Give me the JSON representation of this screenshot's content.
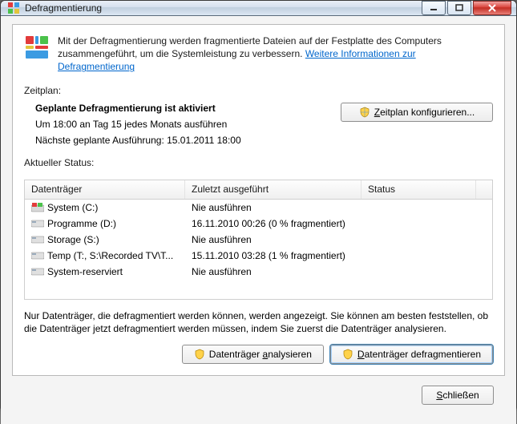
{
  "window": {
    "title": "Defragmentierung"
  },
  "intro": {
    "text": "Mit der Defragmentierung werden fragmentierte Dateien auf der Festplatte des Computers zusammengeführt, um die Systemleistung zu verbessern. ",
    "link": "Weitere Informationen zur Defragmentierung"
  },
  "schedule": {
    "label": "Zeitplan:",
    "heading": "Geplante Defragmentierung ist aktiviert",
    "line1": "Um 18:00 an Tag 15 jedes Monats ausführen",
    "line2": "Nächste geplante Ausführung: 15.01.2011 18:00",
    "configure_btn": "Zeitplan konfigurieren..."
  },
  "status": {
    "label": "Aktueller Status:",
    "columns": {
      "c1": "Datenträger",
      "c2": "Zuletzt ausgeführt",
      "c3": "Status"
    },
    "rows": [
      {
        "name": "System (C:)",
        "last": "Nie ausführen",
        "status": "",
        "win": true
      },
      {
        "name": "Programme (D:)",
        "last": "16.11.2010 00:26 (0 % fragmentiert)",
        "status": ""
      },
      {
        "name": "Storage (S:)",
        "last": "Nie ausführen",
        "status": ""
      },
      {
        "name": "Temp (T:, S:\\Recorded TV\\T...",
        "last": "15.11.2010 03:28 (1 % fragmentiert)",
        "status": ""
      },
      {
        "name": "System-reserviert",
        "last": "Nie ausführen",
        "status": ""
      }
    ]
  },
  "note": "Nur Datenträger, die defragmentiert werden können, werden angezeigt. Sie können am besten feststellen, ob die Datenträger jetzt defragmentiert werden müssen, indem Sie zuerst die Datenträger analysieren.",
  "buttons": {
    "analyze": "Datenträger analysieren",
    "defrag": "Datenträger defragmentieren",
    "close": "Schließen"
  }
}
